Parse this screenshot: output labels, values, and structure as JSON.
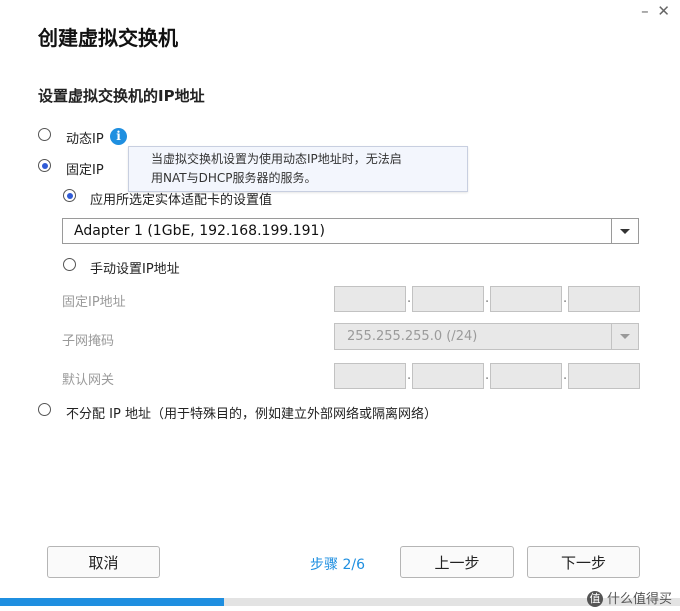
{
  "window": {
    "minimize": "–",
    "close": "✕"
  },
  "title": "创建虚拟交换机",
  "subtitle": "设置虚拟交换机的IP地址",
  "options": {
    "dynamic_ip": {
      "label": "动态IP",
      "checked": false
    },
    "static_ip": {
      "label": "固定IP",
      "checked": true
    },
    "use_adapter": {
      "label": "应用所选定实体适配卡的设置值",
      "checked": true
    },
    "manual": {
      "label": "手动设置IP地址",
      "checked": false
    },
    "none": {
      "label": "不分配 IP 地址（用于特殊目的，例如建立外部网络或隔离网络）",
      "checked": false
    }
  },
  "info_icon": {
    "glyph": "i",
    "icon": "info-icon"
  },
  "tooltip": {
    "line1": "当虚拟交换机设置为使用动态IP地址时，无法启",
    "line2": "用NAT与DHCP服务器的服务。"
  },
  "adapter_select": {
    "value": "Adapter 1 (1GbE, 192.168.199.191)"
  },
  "fields": {
    "static_ip_label": "固定IP地址",
    "subnet_label": "子网掩码",
    "subnet_value": "255.255.255.0 (/24)",
    "gateway_label": "默认网关"
  },
  "buttons": {
    "cancel": "取消",
    "prev": "上一步",
    "next": "下一步"
  },
  "step": "步骤 2/6",
  "progress": 0.33,
  "colors": {
    "accent": "#1f8fe0",
    "radio": "#2f5bd6",
    "disabled": "#e8e8e8"
  },
  "watermark": {
    "logo": "值",
    "text": "什么值得买"
  }
}
